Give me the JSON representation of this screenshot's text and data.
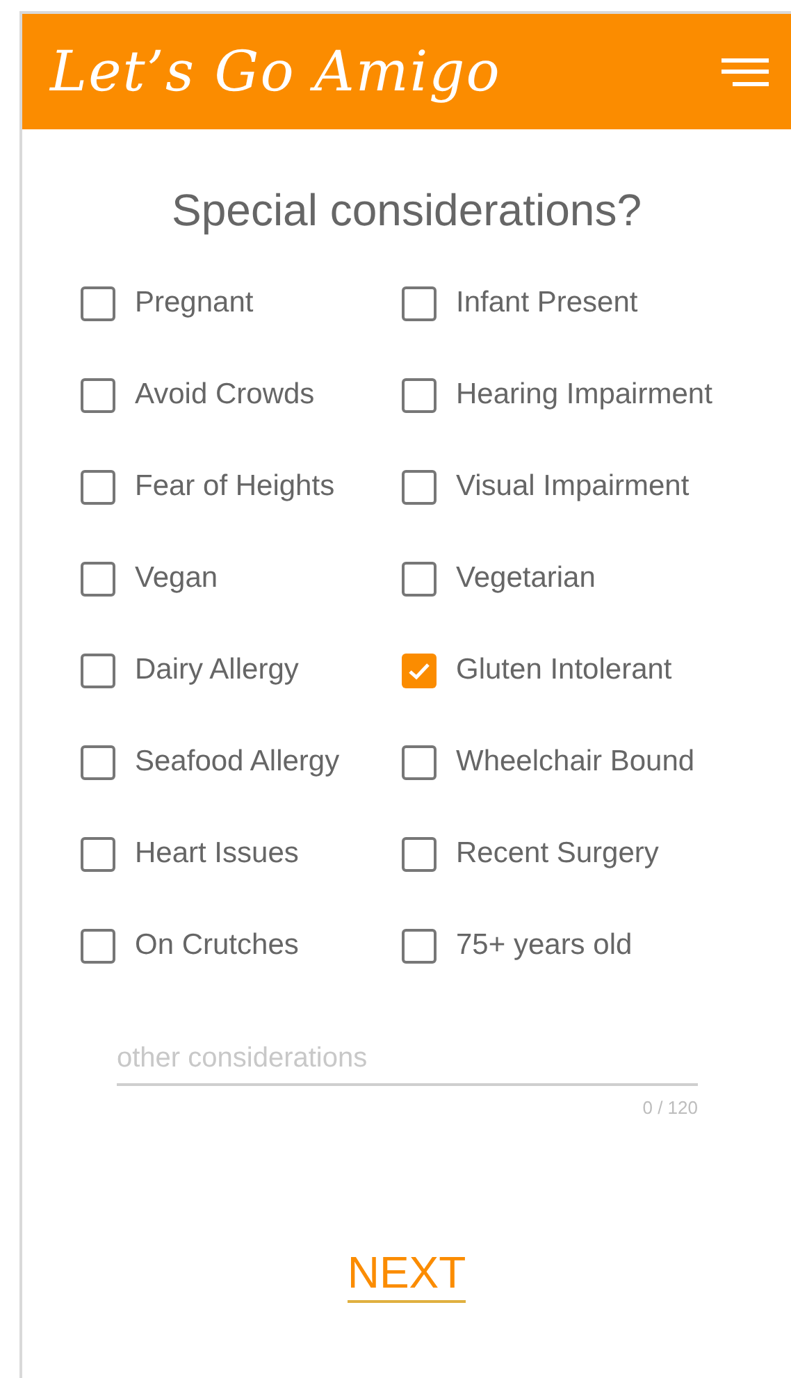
{
  "header": {
    "title": "Let’s Go Amigo"
  },
  "heading": "Special considerations?",
  "options": [
    {
      "label": "Pregnant",
      "checked": false
    },
    {
      "label": "Infant Present",
      "checked": false
    },
    {
      "label": "Avoid Crowds",
      "checked": false
    },
    {
      "label": "Hearing Impairment",
      "checked": false
    },
    {
      "label": "Fear of Heights",
      "checked": false
    },
    {
      "label": "Visual Impairment",
      "checked": false
    },
    {
      "label": "Vegan",
      "checked": false
    },
    {
      "label": "Vegetarian",
      "checked": false
    },
    {
      "label": "Dairy Allergy",
      "checked": false
    },
    {
      "label": "Gluten Intolerant",
      "checked": true
    },
    {
      "label": "Seafood Allergy",
      "checked": false
    },
    {
      "label": "Wheelchair Bound",
      "checked": false
    },
    {
      "label": "Heart Issues",
      "checked": false
    },
    {
      "label": "Recent Surgery",
      "checked": false
    },
    {
      "label": "On Crutches",
      "checked": false
    },
    {
      "label": "75+ years old",
      "checked": false
    }
  ],
  "other_field": {
    "placeholder": "other considerations",
    "counter": "0 / 120"
  },
  "next_button": "NEXT"
}
